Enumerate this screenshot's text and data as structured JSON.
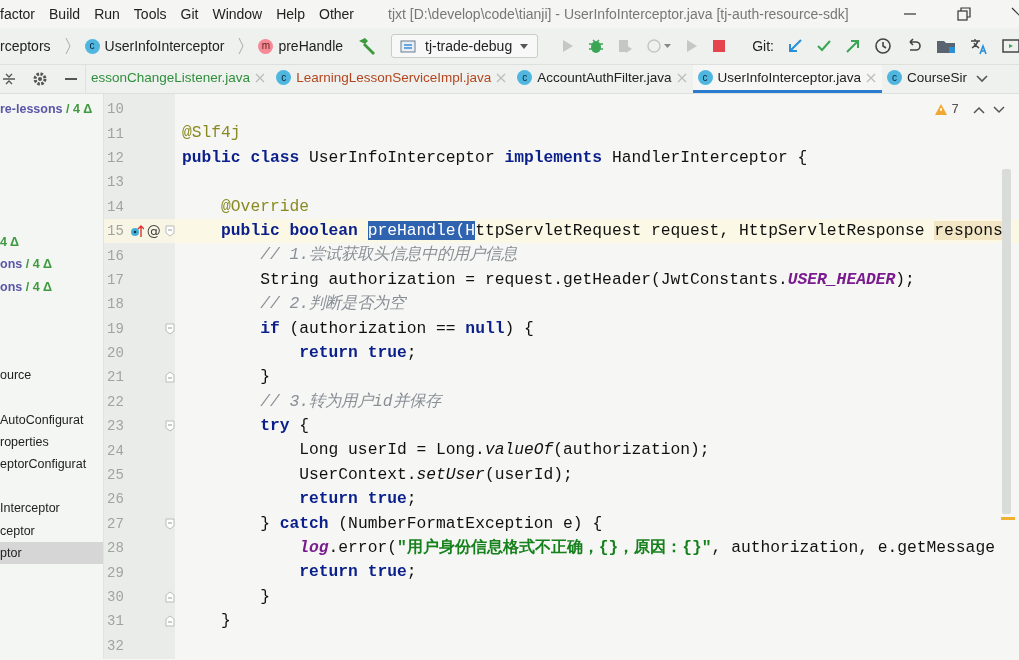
{
  "menu_bar": {
    "items": [
      "factor",
      "Build",
      "Run",
      "Tools",
      "Git",
      "Window",
      "Help",
      "Other"
    ],
    "title": "tjxt [D:\\develop\\code\\tianji] - UserInfoInterceptor.java [tj-auth-resource-sdk]"
  },
  "toolbar": {
    "breadcrumbs": [
      {
        "kind": "package",
        "label": "rceptors"
      },
      {
        "kind": "class",
        "badge": "c",
        "label": "UserInfoInterceptor"
      },
      {
        "kind": "method",
        "badge": "m",
        "label": "preHandle"
      }
    ],
    "run_config": "tj-trade-debug",
    "git_label": "Git:"
  },
  "tabs": [
    {
      "label": "essonChangeListener.java",
      "color": "#2f8f3c",
      "selected": false
    },
    {
      "label": "LearningLessonServiceImpl.java",
      "color": "#b4461f",
      "badge": "c",
      "selected": false
    },
    {
      "label": "AccountAuthFilter.java",
      "color": "#222222",
      "badge": "c",
      "selected": false
    },
    {
      "label": "UserInfoInterceptor.java",
      "color": "#222222",
      "badge": "c",
      "selected": true
    },
    {
      "label": "CourseSir",
      "color": "#222222",
      "badge": "c",
      "selected": false
    }
  ],
  "project_tree": [
    {
      "kind": "text",
      "parts": [
        {
          "kind": "module",
          "text": "re-lessons"
        },
        {
          "kind": "delta",
          "text": " / 4 Δ"
        }
      ],
      "selected": false
    },
    {
      "kind": "blank"
    },
    {
      "kind": "blank"
    },
    {
      "kind": "blank"
    },
    {
      "kind": "blank"
    },
    {
      "kind": "blank"
    },
    {
      "kind": "text",
      "parts": [
        {
          "kind": "delta",
          "text": "4 Δ"
        }
      ],
      "selected": false
    },
    {
      "kind": "text",
      "parts": [
        {
          "kind": "module",
          "text": "ons"
        },
        {
          "kind": "delta",
          "text": " / 4 Δ"
        }
      ],
      "selected": false
    },
    {
      "kind": "text",
      "parts": [
        {
          "kind": "module",
          "text": "ons"
        },
        {
          "kind": "delta",
          "text": " / 4 Δ"
        }
      ],
      "selected": false
    },
    {
      "kind": "blank"
    },
    {
      "kind": "blank"
    },
    {
      "kind": "blank"
    },
    {
      "kind": "text",
      "parts": [
        {
          "kind": "file",
          "text": "ource"
        }
      ],
      "selected": false
    },
    {
      "kind": "blank"
    },
    {
      "kind": "text",
      "parts": [
        {
          "kind": "file",
          "text": "AutoConfigurat"
        }
      ],
      "selected": false
    },
    {
      "kind": "text",
      "parts": [
        {
          "kind": "file",
          "text": "roperties"
        }
      ],
      "selected": false
    },
    {
      "kind": "text",
      "parts": [
        {
          "kind": "file",
          "text": "eptorConfigurat"
        }
      ],
      "selected": false
    },
    {
      "kind": "blank"
    },
    {
      "kind": "text",
      "parts": [
        {
          "kind": "file",
          "text": "Interceptor"
        }
      ],
      "selected": false
    },
    {
      "kind": "text",
      "parts": [
        {
          "kind": "file",
          "text": "ceptor"
        }
      ],
      "selected": false
    },
    {
      "kind": "text",
      "parts": [
        {
          "kind": "file",
          "text": "ptor"
        }
      ],
      "selected": true
    }
  ],
  "editor": {
    "warnings": "7",
    "lines": [
      {
        "num": "10"
      },
      {
        "num": "11",
        "tokens": [
          {
            "kind": "ann",
            "text": "@Slf4j"
          }
        ]
      },
      {
        "num": "12",
        "tokens": [
          {
            "kind": "kw",
            "text": "public class"
          },
          {
            "kind": "plain",
            "text": " UserInfoInterceptor "
          },
          {
            "kind": "kw",
            "text": "implements"
          },
          {
            "kind": "plain",
            "text": " HandlerInterceptor {"
          }
        ]
      },
      {
        "num": "13"
      },
      {
        "num": "14",
        "tokens": [
          {
            "kind": "ann",
            "text": "    @Override"
          }
        ]
      },
      {
        "num": "15",
        "current": true,
        "override_icon": true,
        "mark": "@",
        "fold_start": true,
        "tokens": [
          {
            "kind": "kw",
            "text": "    public boolean "
          },
          {
            "kind": "sel",
            "text": "preHandle(H"
          },
          {
            "kind": "plain",
            "text": "ttpServletRequest request, HttpServletResponse "
          },
          {
            "kind": "hl",
            "text": "respons"
          }
        ]
      },
      {
        "num": "16",
        "tokens": [
          {
            "kind": "comment",
            "text": "        // 1.尝试获取头信息中的用户信息"
          }
        ]
      },
      {
        "num": "17",
        "tokens": [
          {
            "kind": "plain",
            "text": "        String authorization = request.getHeader(JwtConstants."
          },
          {
            "kind": "const",
            "text": "USER_HEADER"
          },
          {
            "kind": "plain",
            "text": ");"
          }
        ]
      },
      {
        "num": "18",
        "tokens": [
          {
            "kind": "comment",
            "text": "        // 2.判断是否为空"
          }
        ]
      },
      {
        "num": "19",
        "fold_start": true,
        "tokens": [
          {
            "kind": "kw",
            "text": "        if"
          },
          {
            "kind": "plain",
            "text": " (authorization == "
          },
          {
            "kind": "kw",
            "text": "null"
          },
          {
            "kind": "plain",
            "text": ") {"
          }
        ]
      },
      {
        "num": "20",
        "tokens": [
          {
            "kind": "kw",
            "text": "            return true"
          },
          {
            "kind": "plain",
            "text": ";"
          }
        ]
      },
      {
        "num": "21",
        "fold_end": true,
        "tokens": [
          {
            "kind": "plain",
            "text": "        }"
          }
        ]
      },
      {
        "num": "22",
        "tokens": [
          {
            "kind": "comment",
            "text": "        // 3.转为用户id并保存"
          }
        ]
      },
      {
        "num": "23",
        "fold_start": true,
        "tokens": [
          {
            "kind": "kw",
            "text": "        try"
          },
          {
            "kind": "plain",
            "text": " {"
          }
        ]
      },
      {
        "num": "24",
        "tokens": [
          {
            "kind": "plain",
            "text": "            Long userId = Long."
          },
          {
            "kind": "italic",
            "text": "valueOf"
          },
          {
            "kind": "plain",
            "text": "(authorization);"
          }
        ]
      },
      {
        "num": "25",
        "tokens": [
          {
            "kind": "plain",
            "text": "            UserContext."
          },
          {
            "kind": "italic",
            "text": "setUser"
          },
          {
            "kind": "plain",
            "text": "(userId);"
          }
        ]
      },
      {
        "num": "26",
        "tokens": [
          {
            "kind": "kw",
            "text": "            return true"
          },
          {
            "kind": "plain",
            "text": ";"
          }
        ]
      },
      {
        "num": "27",
        "fold_start": true,
        "tokens": [
          {
            "kind": "plain",
            "text": "        } "
          },
          {
            "kind": "kw",
            "text": "catch"
          },
          {
            "kind": "plain",
            "text": " (NumberFormatException e) {"
          }
        ]
      },
      {
        "num": "28",
        "tokens": [
          {
            "kind": "const",
            "text": "            log"
          },
          {
            "kind": "plain",
            "text": ".error("
          },
          {
            "kind": "str",
            "text": "\"用户身份信息格式不正确，{}，原因：{}\""
          },
          {
            "kind": "plain",
            "text": ", authorization, e.getMessage"
          }
        ]
      },
      {
        "num": "29",
        "tokens": [
          {
            "kind": "kw",
            "text": "            return true"
          },
          {
            "kind": "plain",
            "text": ";"
          }
        ]
      },
      {
        "num": "30",
        "fold_end": true,
        "tokens": [
          {
            "kind": "plain",
            "text": "        }"
          }
        ]
      },
      {
        "num": "31",
        "fold_end": true,
        "tokens": [
          {
            "kind": "plain",
            "text": "    }"
          }
        ]
      },
      {
        "num": "32"
      }
    ]
  }
}
